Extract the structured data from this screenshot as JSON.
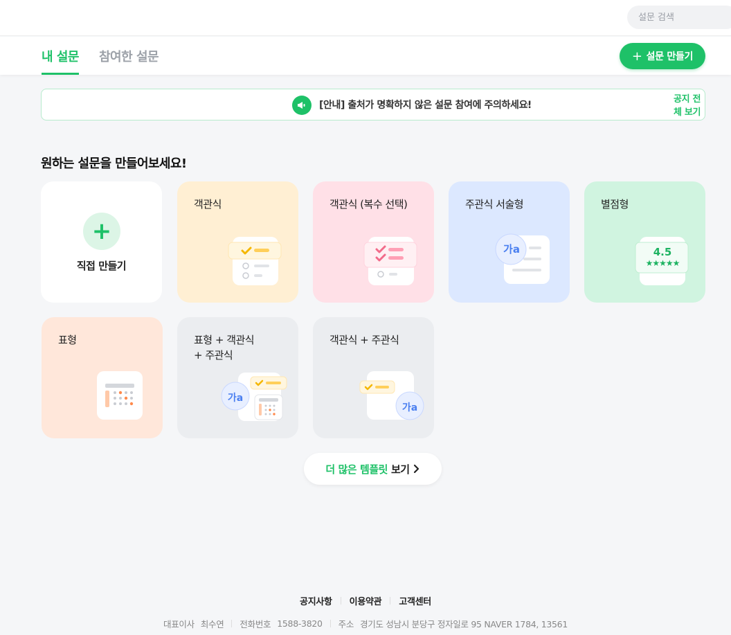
{
  "header": {
    "search_placeholder": "설문 검색"
  },
  "tabs": {
    "my_surveys": "내 설문",
    "participated": "참여한 설문"
  },
  "toolbar": {
    "create_label": "설문 만들기"
  },
  "notice": {
    "text": "[안내] 출처가 명확하지 않은 설문 참여에 주의하세요!",
    "view_all": "공지 전체 보기"
  },
  "section": {
    "title": "원하는 설문을 만들어보세요!"
  },
  "templates": {
    "direct": "직접 만들기",
    "items": [
      {
        "label": "객관식",
        "color": "#ffefd3"
      },
      {
        "label": "객관식 (복수 선택)",
        "color": "#ffe0e7"
      },
      {
        "label": "주관식 서술형",
        "color": "#dce8ff"
      },
      {
        "label": "별점형",
        "color": "#d0f4e0"
      },
      {
        "label": "표형",
        "color": "#ffe7da"
      },
      {
        "label": "표형 + 객관식",
        "label2": "+ 주관식",
        "color": "#ebedf0"
      },
      {
        "label": "객관식 + 주관식",
        "color": "#ebedf0"
      }
    ],
    "rating_value": "4.5",
    "glyph_text": "가a"
  },
  "more_templates": {
    "part1": "더 많은",
    "part2": "템플릿",
    "part3": "보기"
  },
  "footer": {
    "links": [
      "공지사항",
      "이용약관",
      "고객센터"
    ],
    "ceo_label": "대표이사",
    "ceo_name": "최수연",
    "phone_label": "전화번호",
    "phone": "1588-3820",
    "address_label": "주소",
    "address": "경기도 성남시 분당구 정자일로 95 NAVER 1784, 13561"
  },
  "colors": {
    "accent": "#1ec168",
    "notice_border": "#b7ebcd",
    "background": "#f5f6f8"
  }
}
